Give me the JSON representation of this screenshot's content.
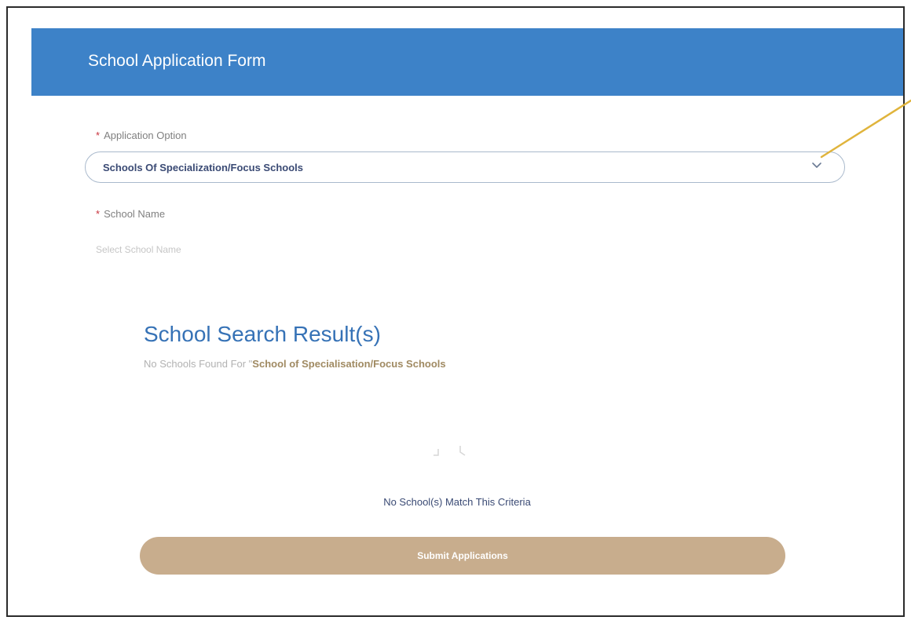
{
  "header": {
    "title": "School Application Form"
  },
  "form": {
    "application_option": {
      "required_mark": "*",
      "label": "Application Option",
      "selected_value": "Schools Of Specialization/Focus Schools",
      "icon": "chevron-down-icon"
    },
    "school_name": {
      "required_mark": "*",
      "label": "School Name",
      "placeholder": "Select School Name"
    }
  },
  "results": {
    "title": "School Search Result(s)",
    "subtitle_prefix": "No Schools Found For \"",
    "subtitle_term": "School of Specialisation/Focus Schools",
    "empty_icon": "empty-state-icon",
    "empty_message": "No School(s) Match This Criteria"
  },
  "actions": {
    "submit_label": "Submit Applications"
  },
  "colors": {
    "header_bg": "#3d82c8",
    "required_mark": "#c8323c",
    "results_title": "#3672b6",
    "search_term": "#a08a62",
    "submit_bg": "#c8ad8d",
    "annotation_arrow": "#e0b43c"
  }
}
